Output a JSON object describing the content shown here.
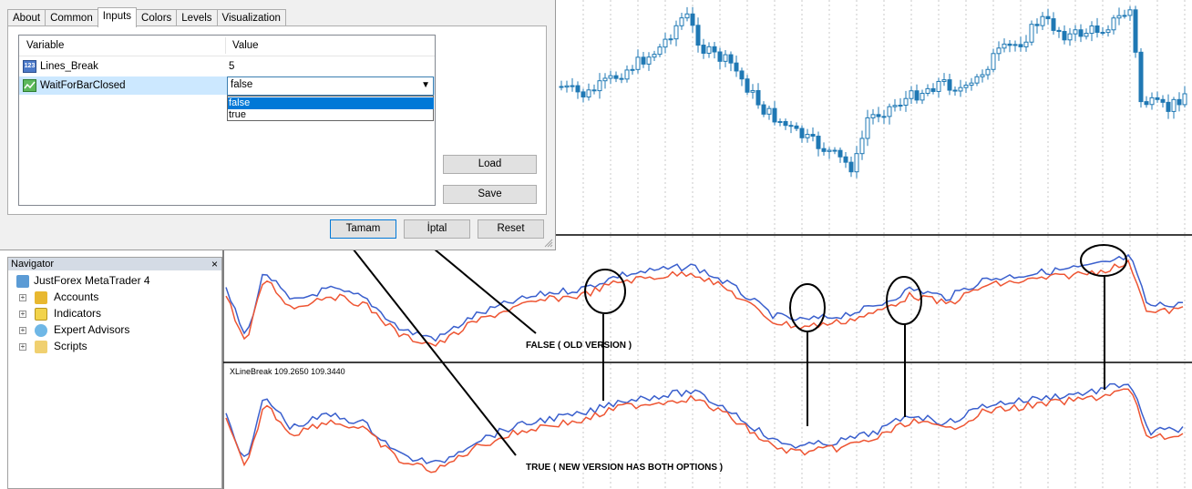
{
  "dialog": {
    "tabs": [
      "About",
      "Common",
      "Inputs",
      "Colors",
      "Levels",
      "Visualization"
    ],
    "active_tab": "Inputs",
    "columns": {
      "variable": "Variable",
      "value": "Value"
    },
    "params": [
      {
        "name": "Lines_Break",
        "value": "5",
        "icon": "integer-param-icon"
      },
      {
        "name": "WaitForBarClosed",
        "value": "false",
        "icon": "boolean-param-icon"
      }
    ],
    "dropdown_options": [
      "false",
      "true"
    ],
    "buttons": {
      "load": "Load",
      "save": "Save",
      "ok": "Tamam",
      "cancel": "İptal",
      "reset": "Reset"
    }
  },
  "navigator": {
    "title": "Navigator",
    "root": "JustForex MetaTrader 4",
    "items": [
      "Accounts",
      "Indicators",
      "Expert Advisors",
      "Scripts"
    ]
  },
  "chart": {
    "indicator_label": "XLineBreak 109.2650 109.3440",
    "annotation_false": "FALSE ( OLD VERSION )",
    "annotation_true": "TRUE ( NEW VERSION HAS BOTH OPTIONS )"
  },
  "colors": {
    "bullish_candle": "#1f78b4",
    "indicator_blue": "#3a5fcd",
    "indicator_red": "#ee5533",
    "highlight": "#0078d7"
  }
}
